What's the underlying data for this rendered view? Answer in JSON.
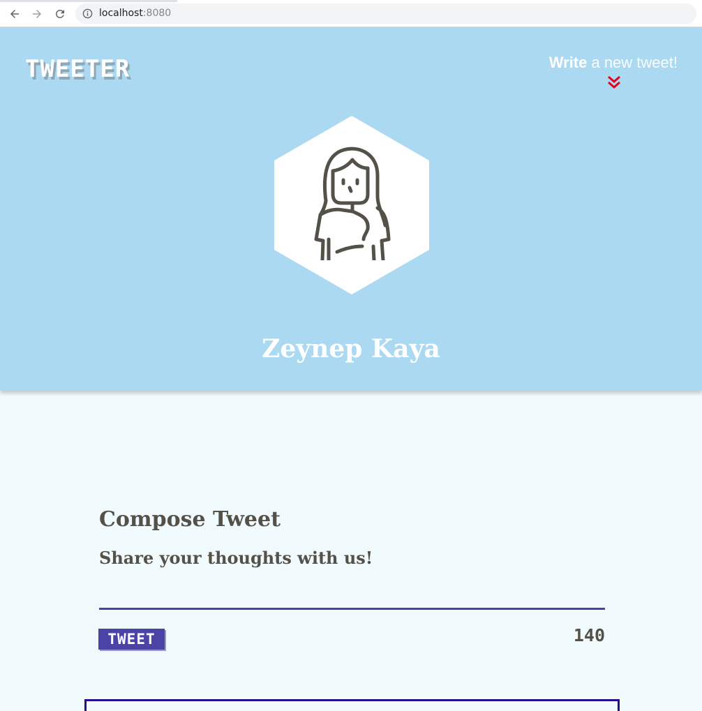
{
  "browser": {
    "url_host": "localhost",
    "url_port": ":8080"
  },
  "header": {
    "logo": "TWEETER",
    "write_bold": "Write",
    "write_rest": " a new tweet!",
    "user_name": "Zeynep Kaya"
  },
  "compose": {
    "title": "Compose Tweet",
    "subtitle": "Share your thoughts with us!",
    "textarea_value": "",
    "button_label": "TWEET",
    "counter": "140"
  },
  "colors": {
    "header_bg": "#acd9f2",
    "page_bg": "#f1fafc",
    "accent": "#4b44a6",
    "chevron": "#e8001c",
    "text": "#545149"
  }
}
